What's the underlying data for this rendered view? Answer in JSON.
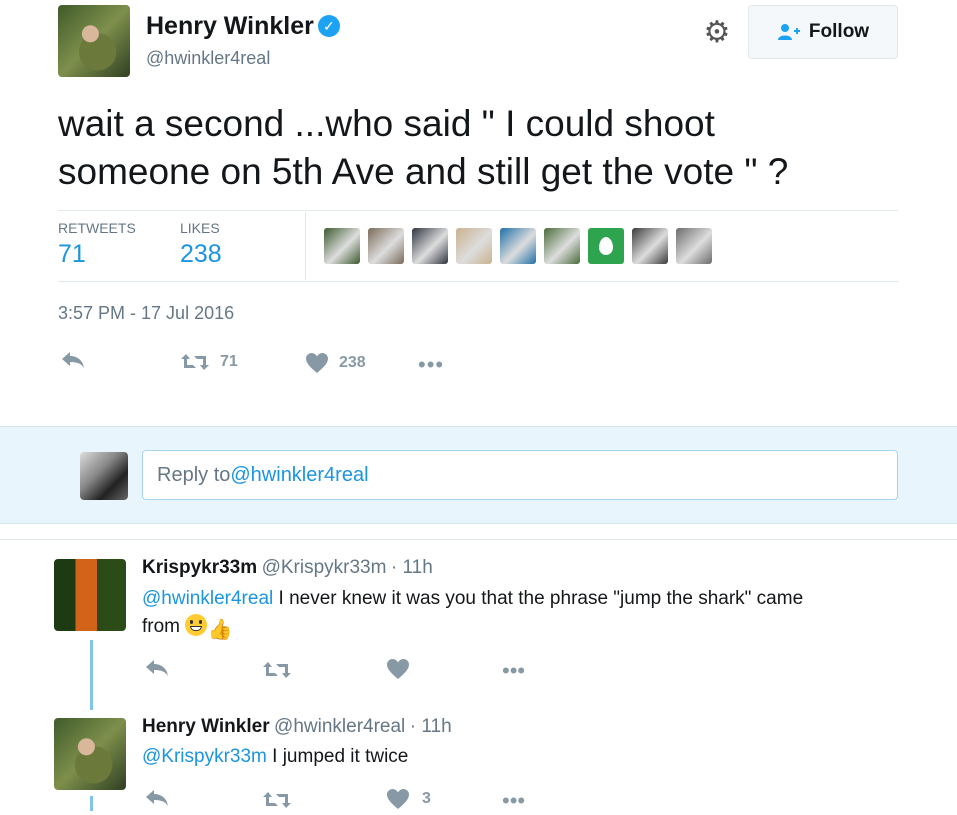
{
  "tweet": {
    "author_name": "Henry Winkler",
    "verified_icon": "verified-badge-icon",
    "author_handle": "@hwinkler4real",
    "follow_label": "Follow",
    "text_line1": "wait a second ...who said \" I could shoot",
    "text_line2": "someone on 5th Ave and still get the vote \"  ?",
    "retweets_label": "RETWEETS",
    "retweets_count": "71",
    "likes_label": "LIKES",
    "likes_count": "238",
    "timestamp": "3:57 PM - 17 Jul 2016",
    "action_retweet_count": "71",
    "action_like_count": "238",
    "liker_avatar_colors": [
      "#3b5a2e",
      "#7a6a5a",
      "#2e3440",
      "#c9b28f",
      "#1f6fa8",
      "#4a6b3a",
      "#2ea44f",
      "#3a3a3a",
      "#6b6b6b"
    ]
  },
  "reply_box": {
    "prefix": "Reply to ",
    "mention": "@hwinkler4real"
  },
  "replies": [
    {
      "name": "Krispykr33m",
      "handle": "@Krispykr33m",
      "time": "· 11h",
      "mention": "@hwinkler4real",
      "text_line1": " I never knew it was you that the phrase \"jump the shark\" came",
      "text_line2": "from ",
      "retweet_count": "",
      "like_count": ""
    },
    {
      "name": "Henry Winkler",
      "handle": "@hwinkler4real",
      "time": "· 11h",
      "mention": "@Krispykr33m",
      "text_line1": " I jumped it twice",
      "like_count": "3"
    }
  ],
  "colors": {
    "link_blue": "#1b95e0",
    "muted": "#657786",
    "reply_panel_bg": "#e8f5fd",
    "like_green_egg": "#2ea44f"
  }
}
